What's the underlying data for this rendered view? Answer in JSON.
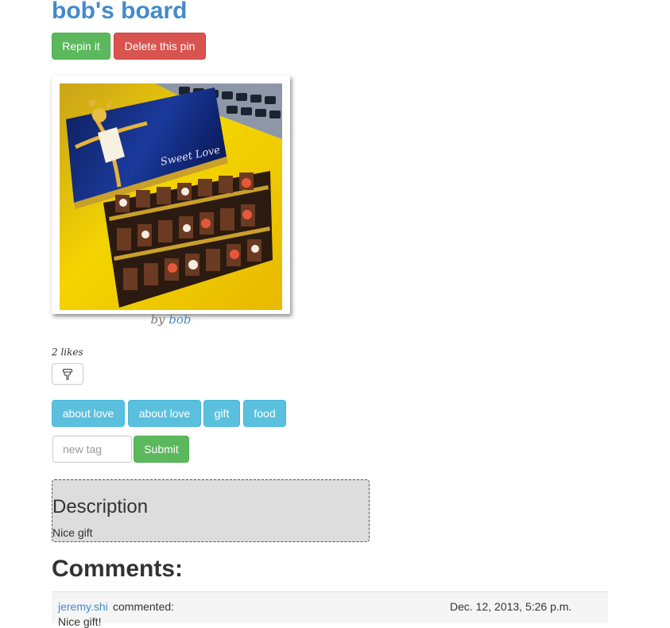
{
  "board": {
    "title": "bob's board"
  },
  "actions": {
    "repin_label": "Repin it",
    "delete_label": "Delete this pin"
  },
  "pin": {
    "image_alt": "chocolate gift box",
    "box_text": "Sweet Love",
    "by_prefix": "by",
    "author": "bob",
    "likes_text": "2 likes",
    "like_icon": "thumbs-down-icon"
  },
  "tags": [
    "about love",
    "about love",
    "gift",
    "food"
  ],
  "tag_form": {
    "placeholder": "new tag",
    "submit_label": "Submit"
  },
  "description": {
    "heading": "Description",
    "text": "Nice gift"
  },
  "comments": {
    "heading": "Comments:",
    "items": [
      {
        "author": "jeremy.shi",
        "verb": "commented:",
        "date": "Dec. 12, 2013, 5:26 p.m.",
        "text": "Nice gift!"
      }
    ]
  },
  "colors": {
    "link": "#428bca",
    "success": "#5cb85c",
    "danger": "#d9534f",
    "info": "#5bc0de",
    "description_bg": "#dddddd"
  }
}
